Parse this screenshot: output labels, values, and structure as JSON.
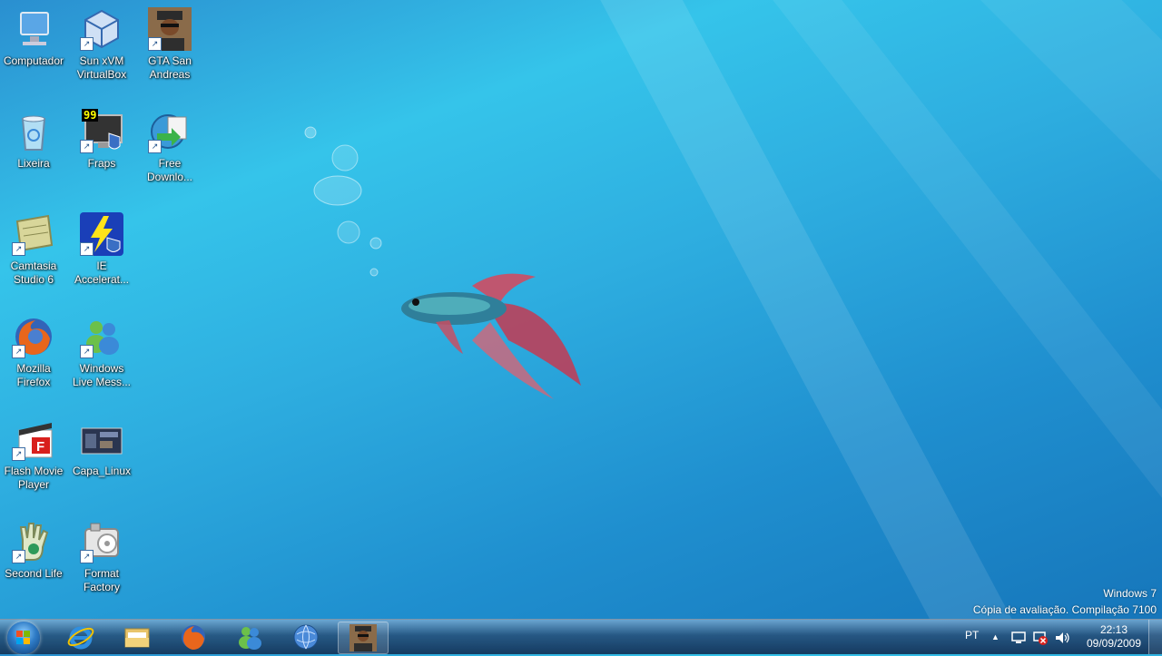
{
  "desktop": {
    "icons": [
      {
        "label": "Computador",
        "icon": "computer-icon"
      },
      {
        "label": "Sun xVM\nVirtualBox",
        "icon": "virtualbox-icon"
      },
      {
        "label": "GTA San\nAndreas",
        "icon": "gta-icon"
      },
      {
        "label": "Lixeira",
        "icon": "recycle-bin-icon"
      },
      {
        "label": "Fraps",
        "icon": "fraps-icon"
      },
      {
        "label": "Free\nDownlo...",
        "icon": "free-download-icon"
      },
      {
        "label": "Camtasia\nStudio 6",
        "icon": "camtasia-icon"
      },
      {
        "label": "IE\nAccelerat...",
        "icon": "ie-accelerator-icon"
      },
      {
        "label": "Mozilla\nFirefox",
        "icon": "firefox-icon"
      },
      {
        "label": "Windows\nLive Mess...",
        "icon": "messenger-icon"
      },
      {
        "label": "Flash Movie\nPlayer",
        "icon": "flash-player-icon"
      },
      {
        "label": "Capa_Linux",
        "icon": "image-file-icon"
      },
      {
        "label": "Second Life",
        "icon": "second-life-icon"
      },
      {
        "label": "Format\nFactory",
        "icon": "format-factory-icon"
      }
    ],
    "fraps_badge": "99"
  },
  "watermark": {
    "line1": "Windows 7",
    "line2": "Cópia de avaliação. Compilação 7100"
  },
  "taskbar": {
    "start_icon": "windows-start-icon",
    "pinned": [
      "internet-explorer-icon",
      "windows-explorer-icon",
      "firefox-icon",
      "messenger-icon",
      "network-globe-icon",
      "gta-icon"
    ],
    "tray": {
      "language": "PT",
      "time": "22:13",
      "date": "09/09/2009"
    }
  },
  "colors": {
    "desktop_light": "#35c4ea",
    "desktop_dark": "#1573b8",
    "taskbar": "#1e4a75"
  }
}
